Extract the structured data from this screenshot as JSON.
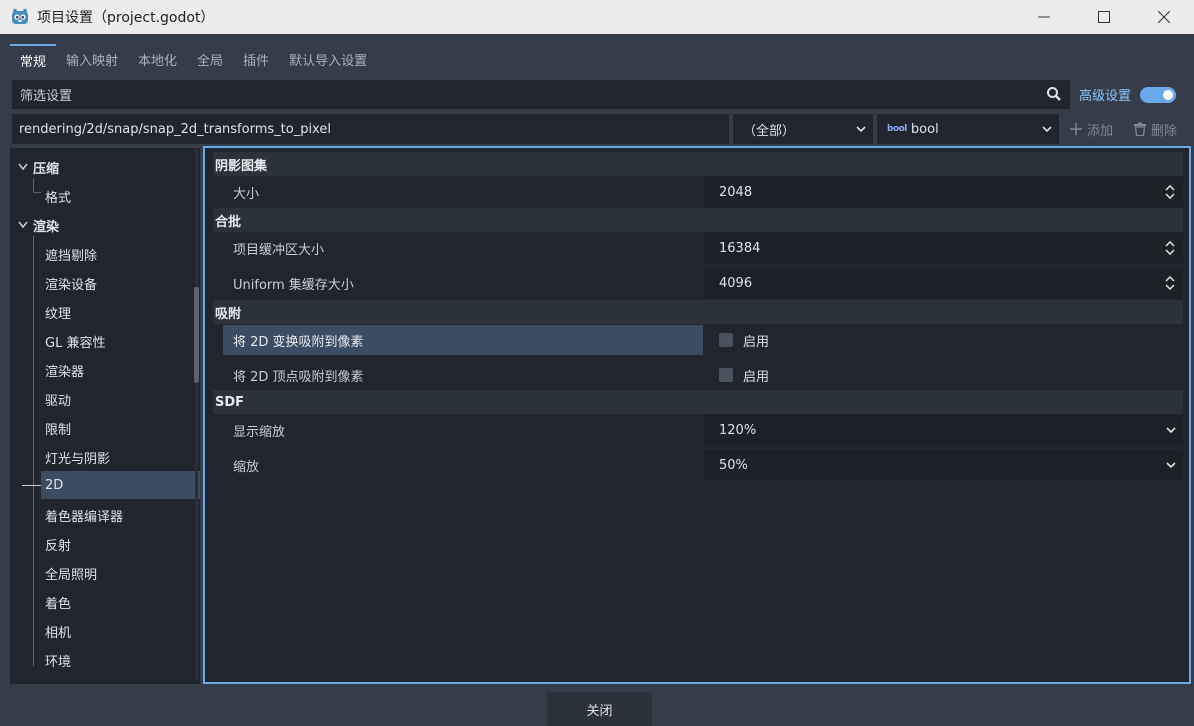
{
  "window": {
    "title": "项目设置（project.godot）"
  },
  "tabs": [
    {
      "label": "常规"
    },
    {
      "label": "输入映射"
    },
    {
      "label": "本地化"
    },
    {
      "label": "全局"
    },
    {
      "label": "插件"
    },
    {
      "label": "默认导入设置"
    }
  ],
  "filter": {
    "placeholder": "筛选设置",
    "advanced_label": "高级设置",
    "advanced_enabled": true
  },
  "property_path": {
    "value": "rendering/2d/snap/snap_2d_transforms_to_pixel",
    "scope_selected": "（全部）",
    "type_badge": "bool",
    "type_selected": "bool",
    "add_label": "添加",
    "delete_label": "删除"
  },
  "tree": {
    "items": [
      {
        "label": "压缩"
      },
      {
        "label": "格式"
      },
      {
        "label": "渲染"
      },
      {
        "label": "遮挡剔除"
      },
      {
        "label": "渲染设备"
      },
      {
        "label": "纹理"
      },
      {
        "label": "GL 兼容性"
      },
      {
        "label": "渲染器"
      },
      {
        "label": "驱动"
      },
      {
        "label": "限制"
      },
      {
        "label": "灯光与阴影"
      },
      {
        "label": "2D"
      },
      {
        "label": "着色器编译器"
      },
      {
        "label": "反射"
      },
      {
        "label": "全局照明"
      },
      {
        "label": "着色"
      },
      {
        "label": "相机"
      },
      {
        "label": "环境"
      }
    ]
  },
  "inspector": {
    "sections": [
      {
        "title": "阴影图集"
      },
      {
        "title": "合批"
      },
      {
        "title": "吸附"
      },
      {
        "title": "SDF"
      }
    ],
    "props": [
      {
        "name": "大小",
        "value": "2048"
      },
      {
        "name": "项目缓冲区大小",
        "value": "16384"
      },
      {
        "name": "Uniform 集缓存大小",
        "value": "4096"
      },
      {
        "name": "将 2D 变换吸附到像素",
        "value": "启用",
        "checked": false
      },
      {
        "name": "将 2D 顶点吸附到像素",
        "value": "启用",
        "checked": false
      },
      {
        "name": "显示缩放",
        "value": "120%"
      },
      {
        "name": "缩放",
        "value": "50%"
      }
    ]
  },
  "footer": {
    "close_label": "关闭"
  }
}
